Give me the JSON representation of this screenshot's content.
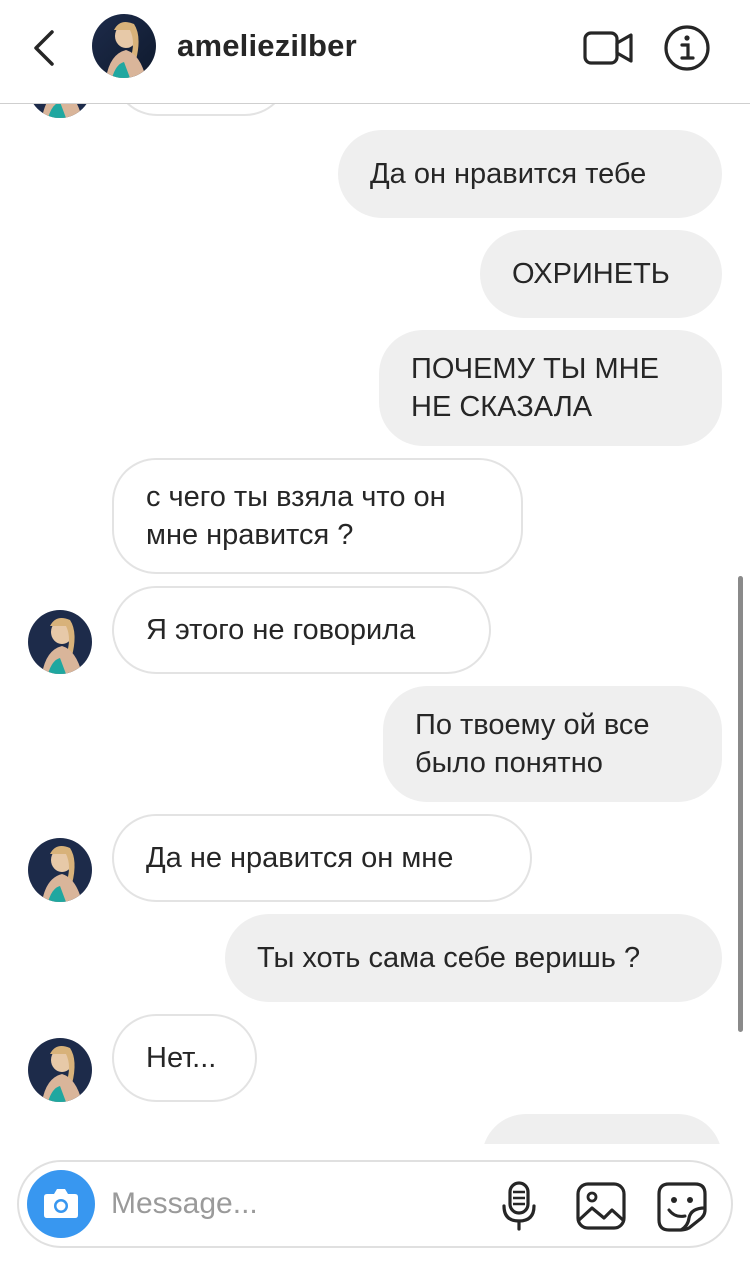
{
  "header": {
    "username": "ameliezilber",
    "icons": {
      "back": "chevron-left-icon",
      "video": "video-camera-icon",
      "info": "info-icon"
    }
  },
  "messages": [
    {
      "from": "them",
      "text": ""
    },
    {
      "from": "me",
      "text": "Да он нравится тебе"
    },
    {
      "from": "me",
      "text": "ОХРИНЕТЬ"
    },
    {
      "from": "me",
      "line1": "ПОЧЕМУ ТЫ МНЕ",
      "line2": "НЕ СКАЗАЛА"
    },
    {
      "from": "them",
      "line1": "с чего ты взяла что он",
      "line2": "мне нравится ?"
    },
    {
      "from": "them",
      "text": "Я этого не говорила"
    },
    {
      "from": "me",
      "line1": "По твоему ой все",
      "line2": "было понятно"
    },
    {
      "from": "them",
      "text": "Да не нравится он мне"
    },
    {
      "from": "me",
      "text": "Ты хоть сама себе веришь ?"
    },
    {
      "from": "them",
      "text": "Нет..."
    },
    {
      "from": "me",
      "text": ""
    }
  ],
  "composer": {
    "placeholder": "Message...",
    "icons": {
      "camera": "camera-icon",
      "mic": "microphone-icon",
      "gallery": "gallery-icon",
      "sticker": "sticker-icon"
    }
  },
  "colors": {
    "accent": "#3897f0",
    "outgoing_bubble": "#efefef",
    "incoming_border": "#e3e3e3",
    "text": "#262626",
    "placeholder": "#9a9a9a"
  }
}
